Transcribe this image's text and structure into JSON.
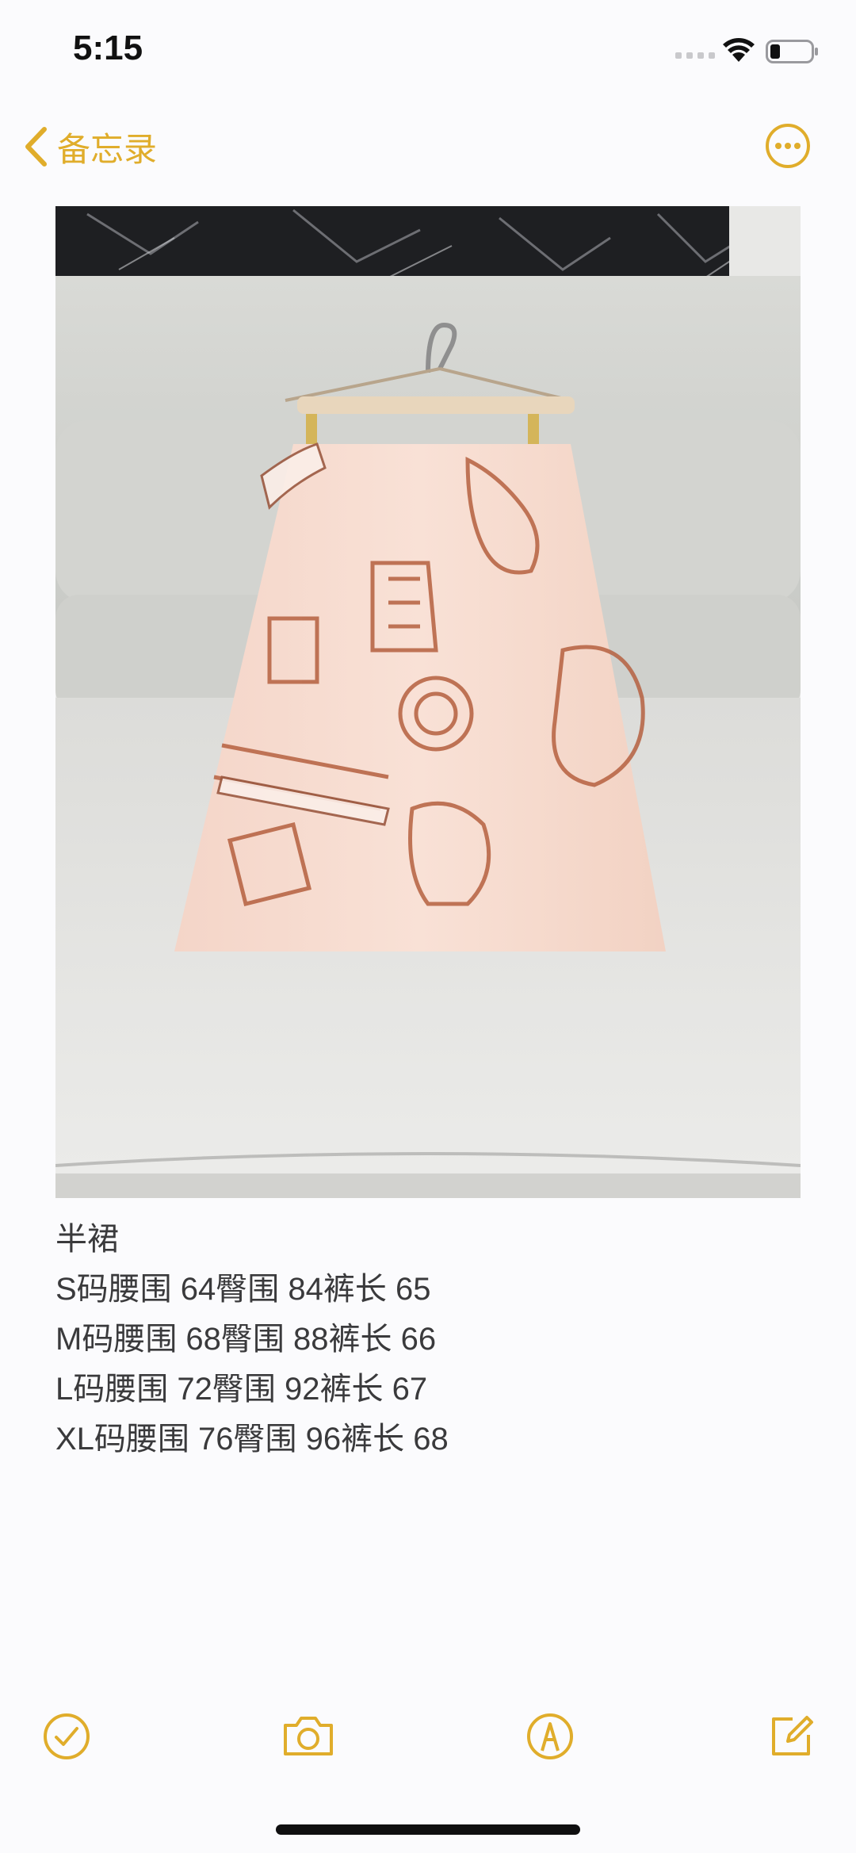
{
  "status_bar": {
    "time": "5:15"
  },
  "nav": {
    "back_label": "备忘录"
  },
  "note": {
    "lines": [
      "半裙",
      "S码腰围 64臀围 84裤长 65",
      "M码腰围 68臀围 88裤长 66",
      "L码腰围 72臀围 92裤长 67",
      "XL码腰围 76臀围 96裤长 68"
    ]
  },
  "toolbar": {
    "icons": [
      "checklist-icon",
      "camera-icon",
      "markup-icon",
      "compose-icon"
    ]
  },
  "colors": {
    "accent": "#e0ad2b",
    "background": "#fbfbfd",
    "text": "#3a3a3c"
  }
}
